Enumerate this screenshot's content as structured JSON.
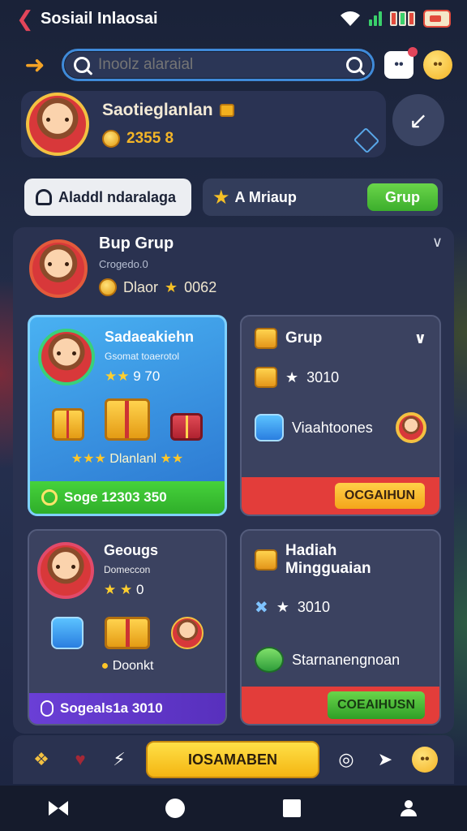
{
  "status": {
    "title": "Sosiail Inlaosai"
  },
  "search": {
    "placeholder": "Inoolz alaraial"
  },
  "profile": {
    "name": "Saotieglanlan",
    "coins": "2355 8"
  },
  "tabs": {
    "left_label": "Aladdl ndaralaga",
    "right_label": "A Mriaup",
    "right_button": "Grup"
  },
  "group": {
    "title": "Bup Grup",
    "subtitle": "Crogedo.0",
    "coins_label": "Dlaor",
    "coins_value": "0062"
  },
  "cards": {
    "blue": {
      "name": "Sadaeakiehn",
      "sub": "Gsomat toaerotol",
      "stars_value": "9 70",
      "label": "Dlanlanl",
      "footer": "Soge 12303 350"
    },
    "c2": {
      "title": "Grup",
      "row1": "3010",
      "row2": "Viaahtoones",
      "button": "OCGAIHUN"
    },
    "c3": {
      "name": "Geougs",
      "sub": "Domeccon",
      "stars_value": "0",
      "label": "Doonkt",
      "footer": "Sogeals1a 3010"
    },
    "c4": {
      "title": "Hadiah Mingguaian",
      "row1": "3010",
      "row2": "Starnanengnoan",
      "button": "COEAIHUSN"
    }
  },
  "actionbar": {
    "main_button": "IOSAMABEN"
  },
  "colors": {
    "accent_green": "#3cae2c",
    "accent_red": "#e33d3a",
    "accent_yellow": "#f4b512",
    "accent_blue": "#3f8ad9"
  },
  "icons": [
    "back-icon",
    "wifi-icon",
    "signal-icon",
    "battery-icon",
    "search-icon",
    "chat-icon",
    "emoji-icon",
    "share-icon",
    "gift-icon",
    "coin-icon",
    "star-icon",
    "chevron-down-icon",
    "home-icon",
    "bowtie-icon",
    "circle-icon",
    "square-icon"
  ]
}
